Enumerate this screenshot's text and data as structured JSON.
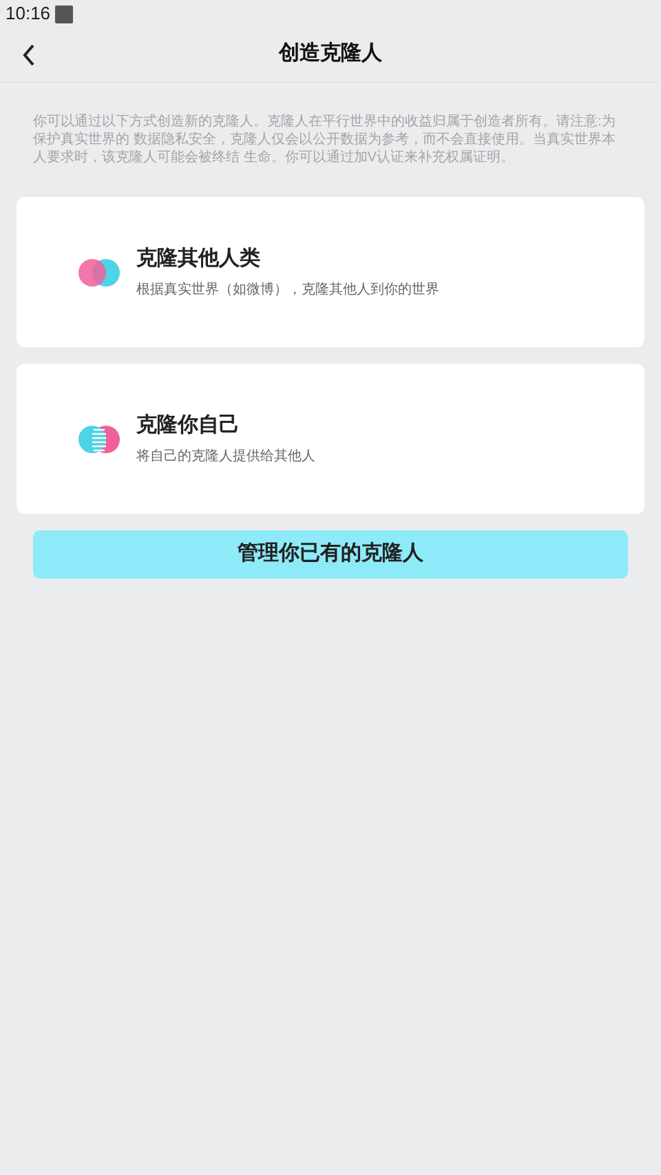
{
  "status_bar": {
    "time": "10:16"
  },
  "header": {
    "title": "创造克隆人"
  },
  "intro": "你可以通过以下方式创造新的克隆人。克隆人在平行世界中的收益归属于创造者所有。请注意:为保护真实世界的 数据隐私安全，克隆人仅会以公开数据为参考，而不会直接使用。当真实世界本人要求时，该克隆人可能会被终结 生命。你可以通过加V认证来补充权属证明。",
  "options": [
    {
      "kind": "others",
      "title": "克隆其他人类",
      "subtitle": "根据真实世界（如微博），克隆其他人到你的世界"
    },
    {
      "kind": "self",
      "title": "克隆你自己",
      "subtitle": "将自己的克隆人提供给其他人"
    }
  ],
  "manage_button": "管理你已有的克隆人"
}
